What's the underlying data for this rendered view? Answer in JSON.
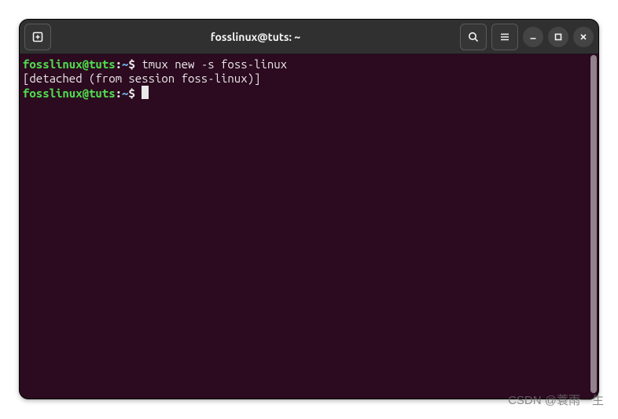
{
  "titlebar": {
    "title": "fosslinux@tuts: ~"
  },
  "prompt": {
    "user_host": "fosslinux@tuts",
    "colon": ":",
    "path": "~",
    "symbol": "$"
  },
  "lines": {
    "cmd1": " tmux new -s foss-linux",
    "output1": "[detached (from session foss-linux)]",
    "cmd2": " "
  },
  "watermark": "CSDN @蓑雨一生"
}
